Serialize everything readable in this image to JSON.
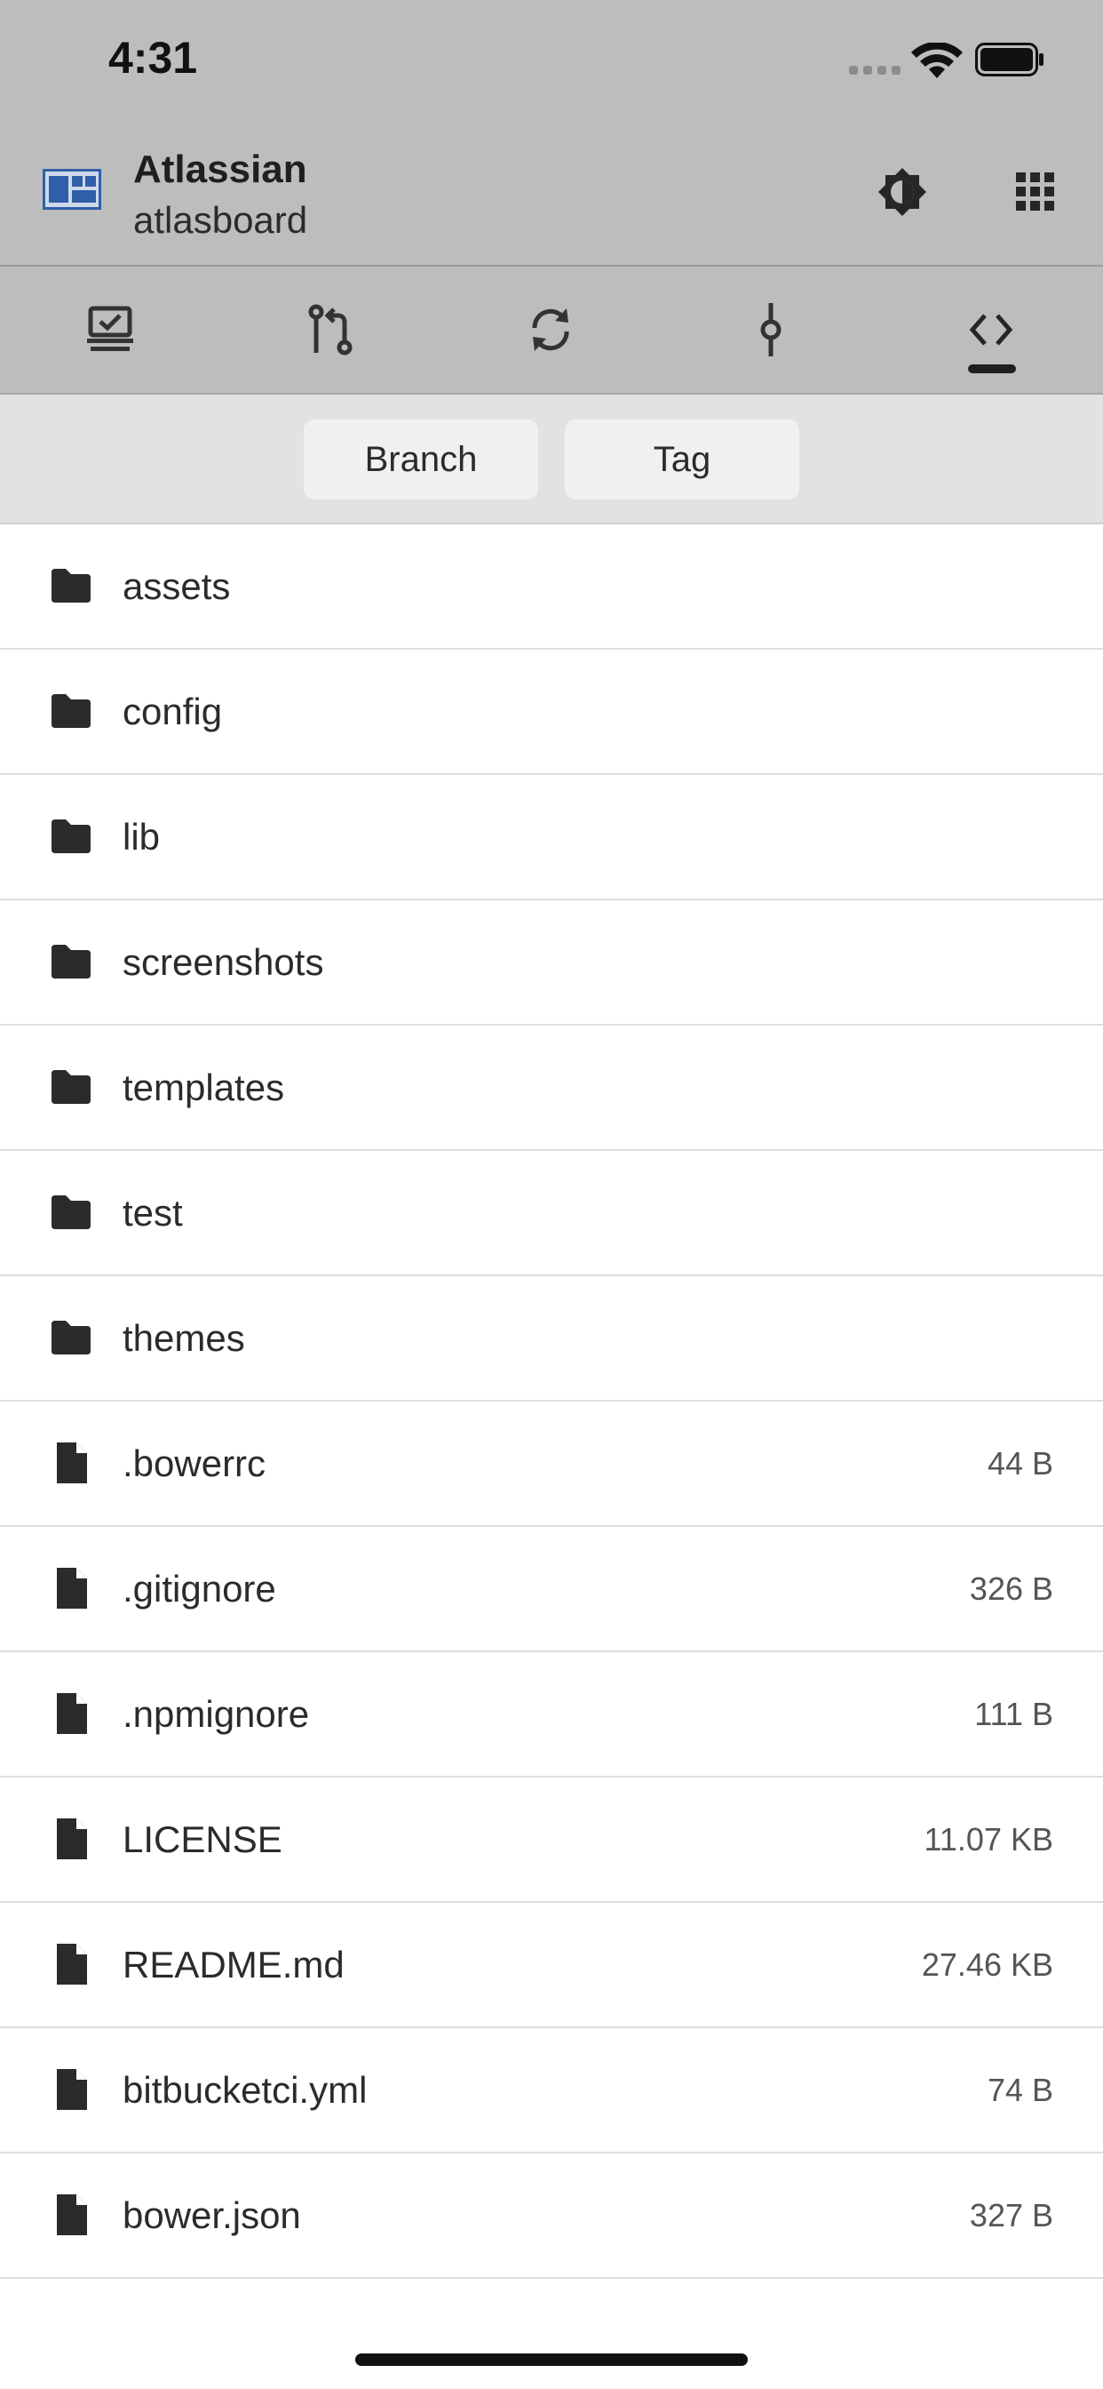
{
  "status_bar": {
    "time": "4:31"
  },
  "header": {
    "title": "Atlassian",
    "subtitle": "atlasboard"
  },
  "tabs": [
    {
      "icon": "dashboard-icon"
    },
    {
      "icon": "pull-request-icon"
    },
    {
      "icon": "sync-icon"
    },
    {
      "icon": "commit-icon"
    },
    {
      "icon": "code-icon",
      "active": true
    }
  ],
  "segment": {
    "branch_label": "Branch",
    "tag_label": "Tag"
  },
  "items": [
    {
      "type": "folder",
      "name": "assets",
      "size": ""
    },
    {
      "type": "folder",
      "name": "config",
      "size": ""
    },
    {
      "type": "folder",
      "name": "lib",
      "size": ""
    },
    {
      "type": "folder",
      "name": "screenshots",
      "size": ""
    },
    {
      "type": "folder",
      "name": "templates",
      "size": ""
    },
    {
      "type": "folder",
      "name": "test",
      "size": ""
    },
    {
      "type": "folder",
      "name": "themes",
      "size": ""
    },
    {
      "type": "file",
      "name": ".bowerrc",
      "size": "44 B"
    },
    {
      "type": "file",
      "name": ".gitignore",
      "size": "326 B"
    },
    {
      "type": "file",
      "name": ".npmignore",
      "size": "111 B"
    },
    {
      "type": "file",
      "name": "LICENSE",
      "size": "11.07 KB"
    },
    {
      "type": "file",
      "name": "README.md",
      "size": "27.46 KB"
    },
    {
      "type": "file",
      "name": "bitbucketci.yml",
      "size": "74 B"
    },
    {
      "type": "file",
      "name": "bower.json",
      "size": "327 B"
    }
  ],
  "colors": {
    "bar_bg": "#bdbdbd",
    "segment_bg": "#e2e2e2",
    "logo_blue": "#2f5fa8"
  }
}
